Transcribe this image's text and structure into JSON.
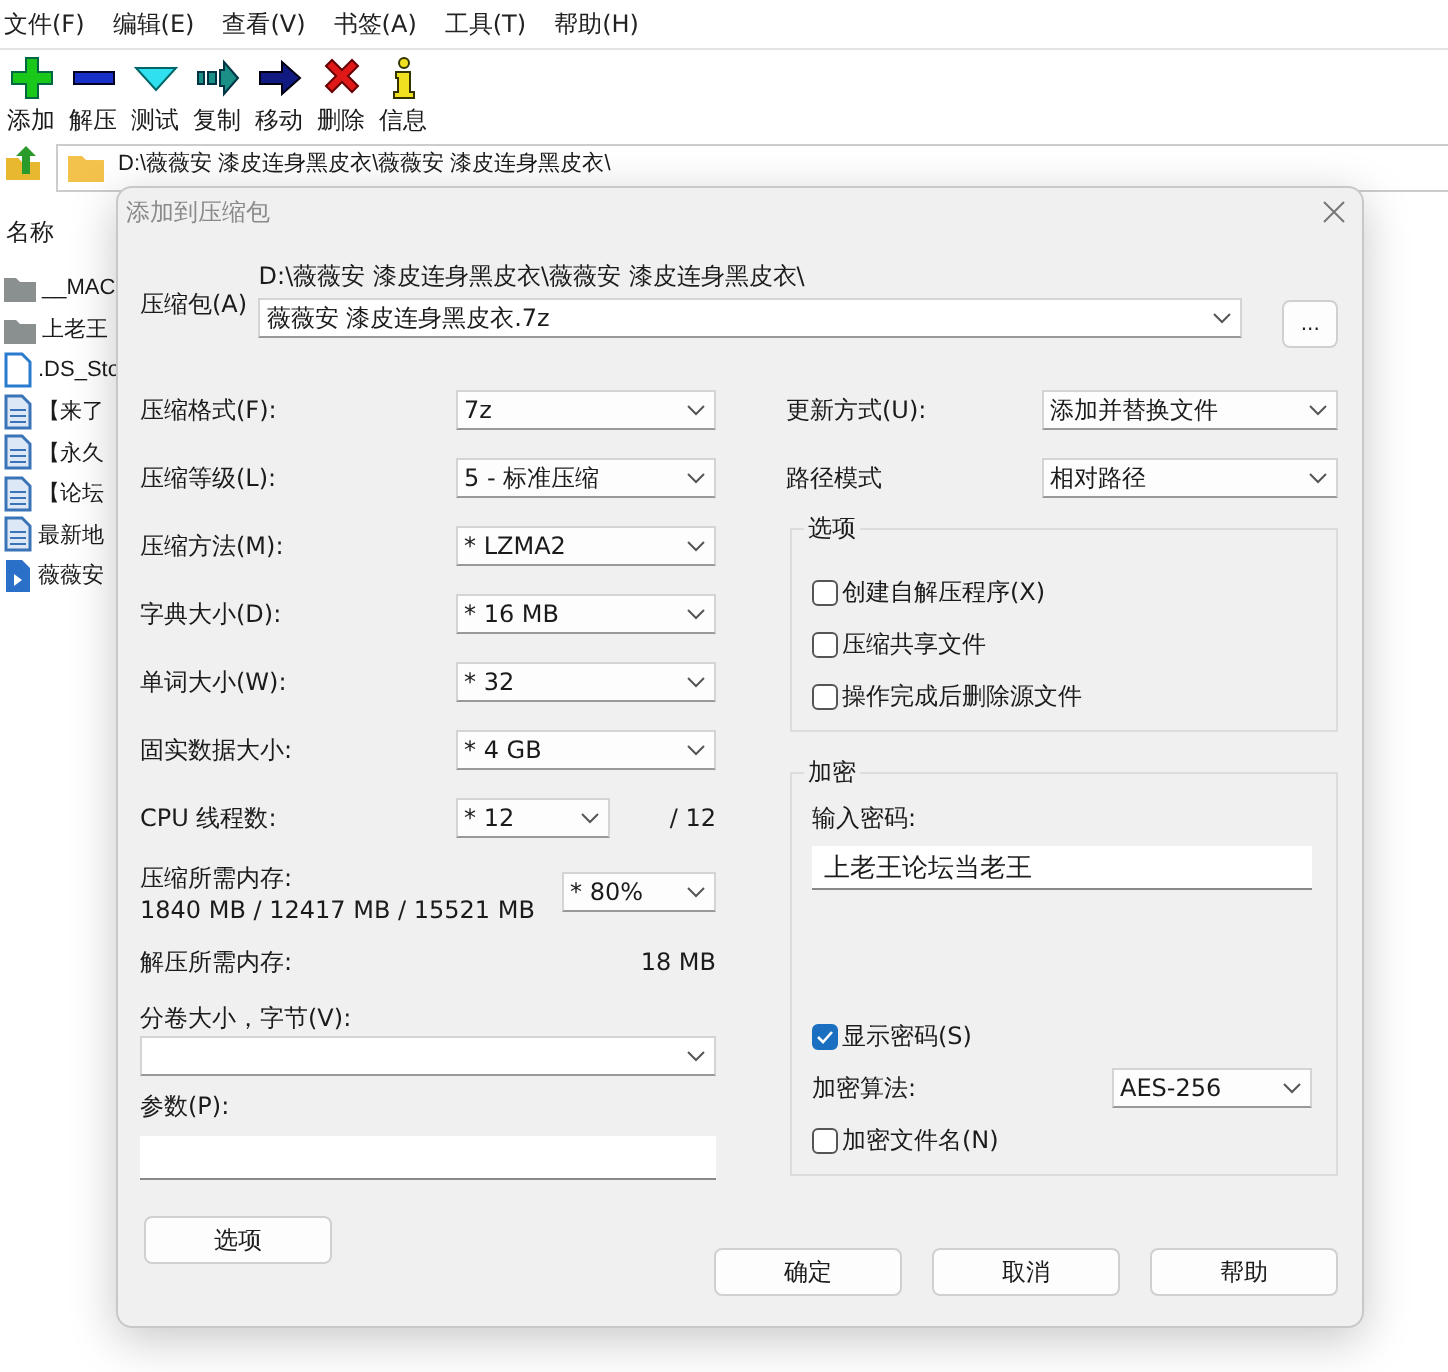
{
  "menu": [
    "文件(F)",
    "编辑(E)",
    "查看(V)",
    "书签(A)",
    "工具(T)",
    "帮助(H)"
  ],
  "toolbar": [
    {
      "label": "添加",
      "kind": "add"
    },
    {
      "label": "解压",
      "kind": "extract"
    },
    {
      "label": "测试",
      "kind": "test"
    },
    {
      "label": "复制",
      "kind": "copy"
    },
    {
      "label": "移动",
      "kind": "move"
    },
    {
      "label": "删除",
      "kind": "delete"
    },
    {
      "label": "信息",
      "kind": "info"
    }
  ],
  "address": {
    "path": "D:\\薇薇安 漆皮连身黑皮衣\\薇薇安 漆皮连身黑皮衣\\"
  },
  "file_list": {
    "header": "名称",
    "items": [
      {
        "name": "__MAC",
        "kind": "folder"
      },
      {
        "name": "上老王",
        "kind": "folder"
      },
      {
        "name": ".DS_Sto",
        "kind": "file"
      },
      {
        "name": "【来了",
        "kind": "doc"
      },
      {
        "name": "【永久",
        "kind": "doc"
      },
      {
        "name": "【论坛",
        "kind": "doc"
      },
      {
        "name": "最新地",
        "kind": "doc"
      },
      {
        "name": "薇薇安",
        "kind": "video"
      }
    ]
  },
  "dialog": {
    "title": "添加到压缩包",
    "archive": {
      "label": "压缩包(A)",
      "folder": "D:\\薇薇安 漆皮连身黑皮衣\\薇薇安 漆皮连身黑皮衣\\",
      "name": "薇薇安 漆皮连身黑皮衣.7z",
      "browse": "..."
    },
    "settings": [
      {
        "label": "压缩格式(F):",
        "value": "7z"
      },
      {
        "label": "压缩等级(L):",
        "value": "5 - 标准压缩"
      },
      {
        "label": "压缩方法(M):",
        "value": "*  LZMA2"
      },
      {
        "label": "字典大小(D):",
        "value": "*  16 MB"
      },
      {
        "label": "单词大小(W):",
        "value": "*  32"
      },
      {
        "label": "固实数据大小:",
        "value": "*  4 GB"
      }
    ],
    "threads": {
      "label": "CPU 线程数:",
      "value": "*  12",
      "total": "/ 12"
    },
    "memory": {
      "label": "压缩所需内存:",
      "usage": "1840 MB / 12417 MB / 15521 MB",
      "value": "*  80%"
    },
    "decompress_memory": {
      "label": "解压所需内存:",
      "value": "18 MB"
    },
    "volume": {
      "label": "分卷大小，字节(V):"
    },
    "parameters": {
      "label": "参数(P):"
    },
    "options_button": "选项",
    "update_mode": {
      "label": "更新方式(U):",
      "value": "添加并替换文件"
    },
    "path_mode": {
      "label": "路径模式",
      "value": "相对路径"
    },
    "options_group": {
      "title": "选项",
      "checkboxes": [
        {
          "label": "创建自解压程序(X)",
          "checked": false
        },
        {
          "label": "压缩共享文件",
          "checked": false
        },
        {
          "label": "操作完成后删除源文件",
          "checked": false
        }
      ]
    },
    "encryption": {
      "title": "加密",
      "password_label": "输入密码:",
      "password": "上老王论坛当老王",
      "show_password": {
        "label": "显示密码(S)",
        "checked": true
      },
      "method": {
        "label": "加密算法:",
        "value": "AES-256"
      },
      "encrypt_names": {
        "label": "加密文件名(N)",
        "checked": false
      }
    },
    "buttons": [
      "确定",
      "取消",
      "帮助"
    ]
  }
}
